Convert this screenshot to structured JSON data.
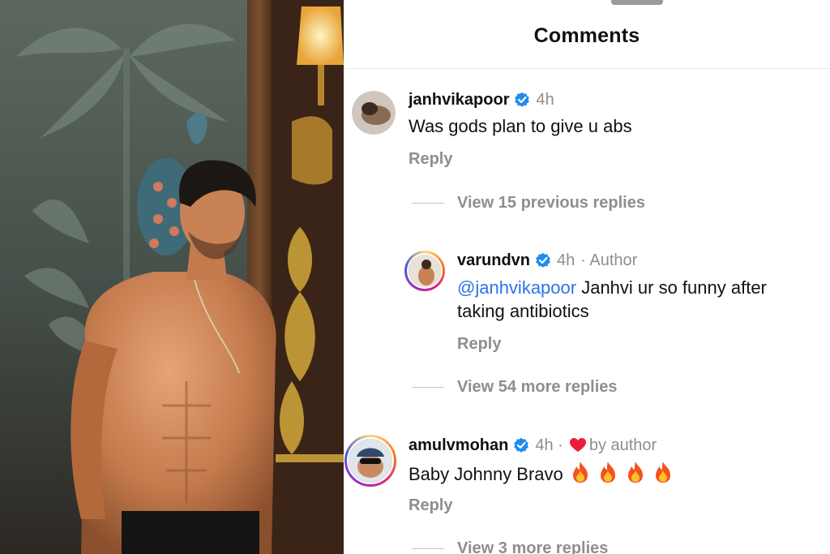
{
  "header": {
    "title": "Comments"
  },
  "comments": [
    {
      "username": "janhvikapoor",
      "time": "4h",
      "text": "Was gods plan to give u abs",
      "reply_label": "Reply",
      "view_replies_label": "View 15 previous replies",
      "avatar_icon": "avatar-photo"
    },
    {
      "username": "varundvn",
      "time": "4h",
      "badge": "· Author",
      "mention": "@janhvikapoor",
      "text": " Janhvi ur so funny after",
      "text_line2": "taking antibiotics",
      "reply_label": "Reply",
      "view_replies_label": "View 54 more replies",
      "avatar_icon": "avatar-photo"
    },
    {
      "username": "amulvmohan",
      "time": "4h ·",
      "liked_by": "by author",
      "text": "Baby Johnny Bravo",
      "emoji_icon": "fire-icon",
      "emoji_count": 4,
      "reply_label": "Reply",
      "view_replies_label": "View 3 more replies",
      "avatar_icon": "avatar-photo"
    }
  ],
  "icons": {
    "verified": "verified-badge-icon",
    "liked": "heart-icon",
    "fire": "fire-icon"
  },
  "colors": {
    "verified_blue": "#1f8cf0",
    "heart_red": "#ed1c39",
    "mention_blue": "#2d74e6",
    "muted_text": "#8e8e8e"
  }
}
